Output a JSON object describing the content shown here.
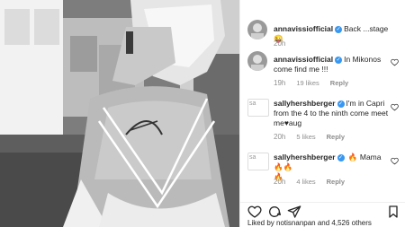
{
  "comments": [
    {
      "user": "annavissiofficial",
      "text": "Back ...stage",
      "emoji": "😜",
      "time": "20h",
      "likes": "",
      "reply": ""
    },
    {
      "user": "annavissiofficial",
      "text": "In Mikonos come find me !!!",
      "time": "19h",
      "likes": "19 likes",
      "reply": "Reply"
    },
    {
      "user": "sallyhershberger",
      "text": "I'm in Capri from the 4 to the ninth come meet me",
      "heart": "♥",
      "tail": "aug",
      "time": "20h",
      "likes": "5 likes",
      "reply": "Reply",
      "avatar_alt": "sa"
    },
    {
      "user": "sallyhershberger",
      "text": "Mama",
      "emoji": "🔥",
      "emoji_tail": "🔥🔥",
      "emoji_tail2": "🔥",
      "time": "20h",
      "likes": "4 likes",
      "reply": "Reply",
      "avatar_alt": "sa"
    }
  ],
  "likes_line": "Liked by notisnanpan and 4,526 others",
  "icons": [
    "heart-icon",
    "comment-icon",
    "share-icon",
    "bookmark-icon",
    "verified-badge-icon"
  ],
  "colors": {
    "verified": "#3897f0",
    "meta": "#8e8e8e",
    "text": "#262626"
  }
}
